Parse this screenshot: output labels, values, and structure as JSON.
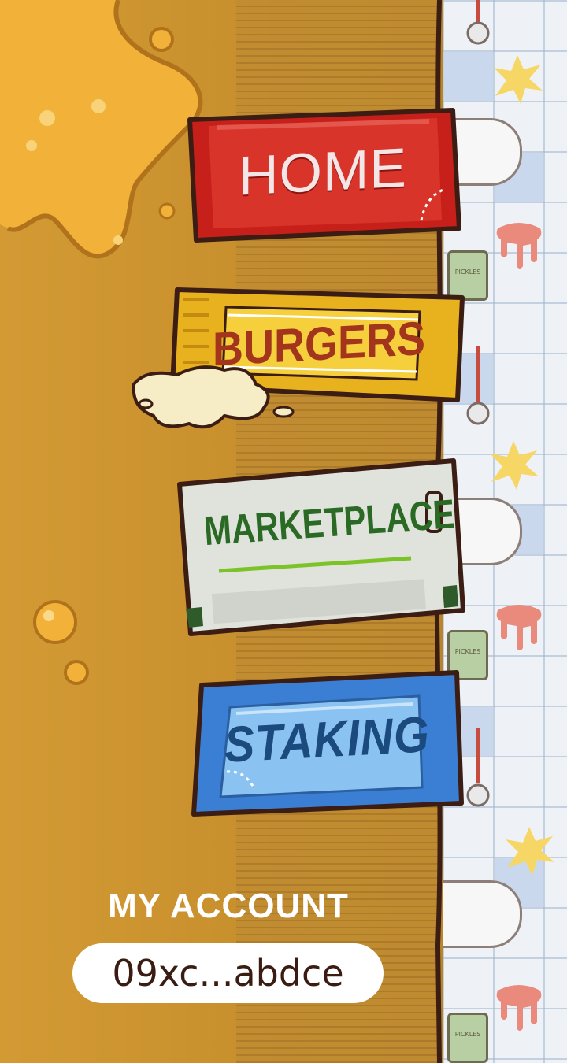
{
  "menu": {
    "items": [
      {
        "label": "HOME",
        "color": "#c7201a"
      },
      {
        "label": "BURGERS",
        "color": "#e8b21f"
      },
      {
        "label": "MARKETPLACE",
        "color": "#dfe3dc"
      },
      {
        "label": "STAKING",
        "color": "#3a7fd3"
      }
    ]
  },
  "account": {
    "title": "MY ACCOUNT",
    "address": "09xc...abdce"
  },
  "decor": {
    "jar_label": "PICKLES"
  }
}
